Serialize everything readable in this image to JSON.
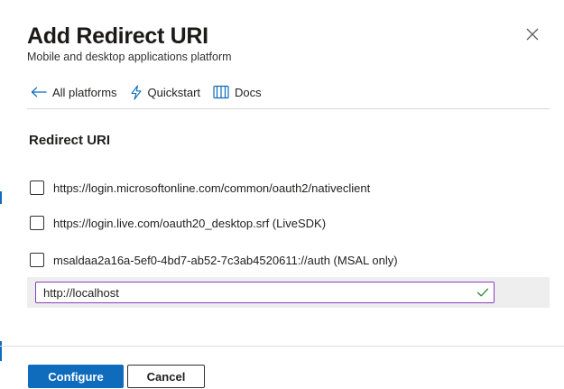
{
  "header": {
    "title": "Add Redirect URI",
    "subtitle": "Mobile and desktop applications platform",
    "close_icon": "close-icon"
  },
  "nav": {
    "items": [
      {
        "label": "All platforms",
        "icon": "arrow-left-icon"
      },
      {
        "label": "Quickstart",
        "icon": "lightning-icon"
      },
      {
        "label": "Docs",
        "icon": "book-icon"
      }
    ]
  },
  "section": {
    "title": "Redirect URI"
  },
  "redirect_uris": [
    {
      "label": "https://login.microsoftonline.com/common/oauth2/nativeclient",
      "checked": false
    },
    {
      "label": "https://login.live.com/oauth20_desktop.srf (LiveSDK)",
      "checked": false
    },
    {
      "label": "msaldaa2a16a-5ef0-4bd7-ab52-7c3ab4520611://auth (MSAL only)",
      "checked": false
    }
  ],
  "custom_uri": {
    "value": "http://localhost",
    "valid": true,
    "valid_icon": "checkmark-icon"
  },
  "footer": {
    "configure_label": "Configure",
    "cancel_label": "Cancel"
  },
  "colors": {
    "accent": "#0f6cbd",
    "input_focus_border": "#8a3cc0",
    "valid_check": "#2e8b3d",
    "row_highlight": "#eeeeee"
  }
}
